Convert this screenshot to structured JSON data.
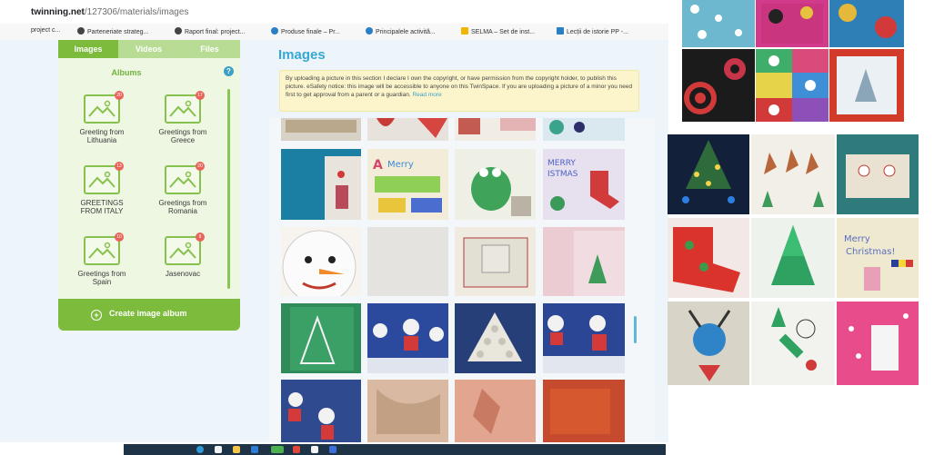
{
  "browser": {
    "url_domain": "twinning.net",
    "url_path": "/127306/materials/images",
    "bookmarks": [
      "project c...",
      "Parteneriate strateg...",
      "Raport final: project...",
      "Produse finale – Pr...",
      "Principalele activită...",
      "SELMA – Set de inst...",
      "Lecții de istorie PP -..."
    ]
  },
  "sidebar": {
    "tabs": [
      "Images",
      "Videos",
      "Files"
    ],
    "albums_title": "Albums",
    "help": "?",
    "albums": [
      {
        "label": "Greeting from Lithuania",
        "count": "20"
      },
      {
        "label": "Greetings from Greece",
        "count": "17"
      },
      {
        "label": "GREETINGS FROM ITALY",
        "count": "13"
      },
      {
        "label": "Greetings from Romania",
        "count": "20"
      },
      {
        "label": "Greetings from Spain",
        "count": "10"
      },
      {
        "label": "Jasenovac",
        "count": "8"
      }
    ],
    "create_button": "Create image album"
  },
  "main": {
    "title": "Images",
    "notice": "By uploading a picture in this section I declare I own the copyright, or have permission from the copyright holder, to publish this picture. eSafety notice: this image will be accessible to anyone on this TwinSpace. If you are uploading a picture of a minor you need first to get approval from a parent or a guardian.",
    "notice_link": "Read more"
  },
  "colors": {
    "green": "#7dbb3d",
    "blue_title": "#35a7d4",
    "notice_bg": "#fcf5cc",
    "sidebar_bg": "#eef7e2"
  },
  "icons": {
    "album": "image-icon",
    "help": "help-icon",
    "create": "plus-circle-icon"
  }
}
